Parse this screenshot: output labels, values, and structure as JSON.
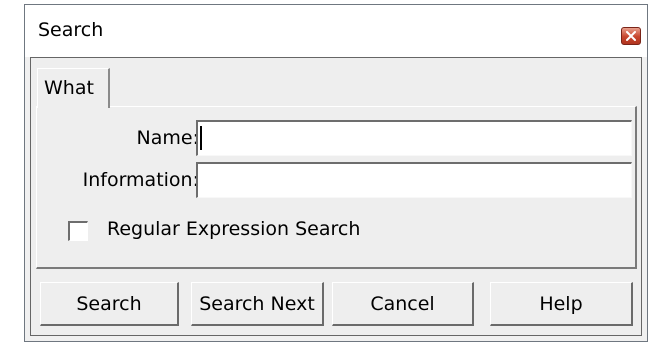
{
  "window": {
    "title": "Search"
  },
  "tabs": [
    {
      "label": "What",
      "selected": true
    }
  ],
  "form": {
    "name_label": "Name:",
    "name_value": "",
    "information_label": "Information:",
    "information_value": "",
    "regex_label": "Regular Expression Search",
    "regex_checked": false
  },
  "buttons": {
    "search": "Search",
    "search_next": "Search Next",
    "cancel": "Cancel",
    "help": "Help"
  },
  "icons": {
    "close": "close-icon"
  },
  "colors": {
    "close_button": "#c7452d",
    "dialog_background": "#eeeeee"
  }
}
